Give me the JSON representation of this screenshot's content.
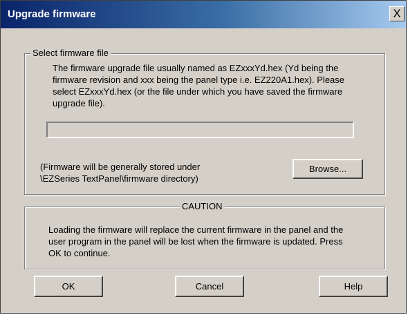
{
  "window": {
    "title": "Upgrade firmware",
    "close_glyph": "X"
  },
  "select_group": {
    "legend": "Select firmware file",
    "description": "The firmware upgrade file usually named as EZxxxYd.hex (Yd being the firmware revision and  xxx being the panel type  i.e. EZ220A1.hex). Please select EZxxxYd.hex (or the file  under which you have saved the firmware upgrade file).",
    "path_value": "",
    "note_line1": "(Firmware will be generally stored under",
    "note_line2": "\\EZSeries TextPanel\\firmware directory)",
    "browse_label": "Browse..."
  },
  "caution_group": {
    "legend": "CAUTION",
    "message": "Loading the firmware will replace the current firmware in the panel and the user program in the panel will be lost when the firmware is updated. Press OK to continue."
  },
  "buttons": {
    "ok": "OK",
    "cancel": "Cancel",
    "help": "Help"
  },
  "colors": {
    "dialog_face": "#d4d0c8",
    "titlebar_start": "#0a246a",
    "titlebar_end": "#a6caf0"
  }
}
